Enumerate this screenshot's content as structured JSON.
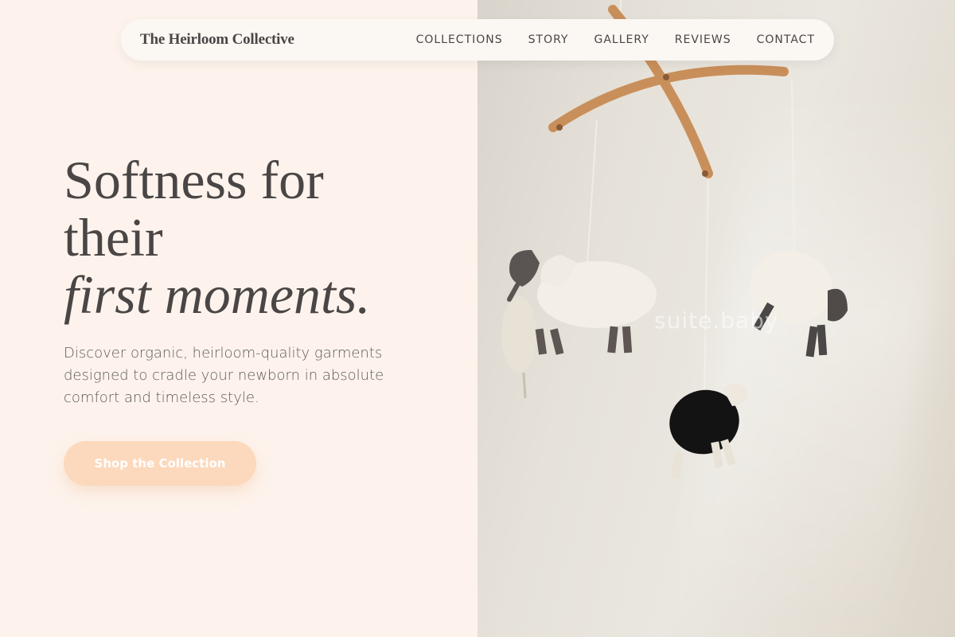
{
  "brand": {
    "name": "The Heirloom Collective"
  },
  "nav": {
    "items": [
      {
        "label": "COLLECTIONS"
      },
      {
        "label": "STORY"
      },
      {
        "label": "GALLERY"
      },
      {
        "label": "REVIEWS"
      },
      {
        "label": "CONTACT"
      }
    ]
  },
  "hero": {
    "headline_line1": "Softness for",
    "headline_line2": "their",
    "headline_italic": "first moments.",
    "subtext": "Discover organic, heirloom-quality garments designed to cradle your newborn in absolute comfort and timeless style.",
    "cta_label": "Shop the Collection"
  },
  "image": {
    "watermark": "suite.baby"
  },
  "colors": {
    "background": "#fdf3ec",
    "accent": "#fcd8bc",
    "text": "#4a4646"
  }
}
